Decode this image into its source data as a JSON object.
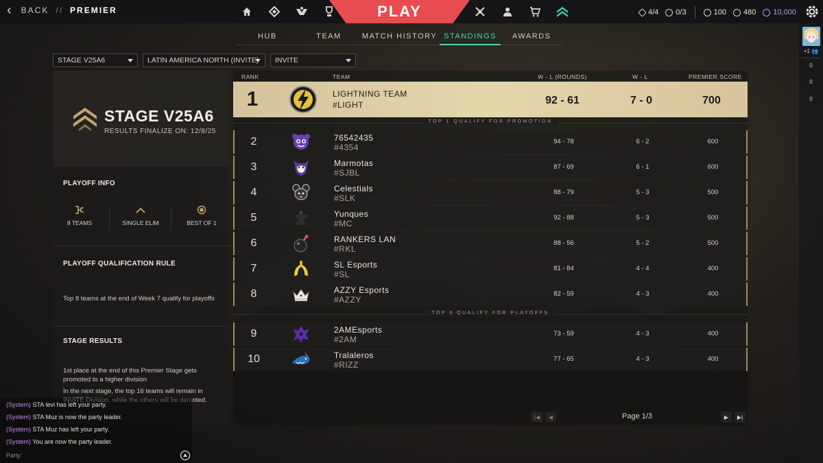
{
  "topbar": {
    "back_label": "BACK",
    "separator": "//",
    "current": "PREMIER",
    "play_label": "PLAY",
    "nav_left_icons": [
      "home-icon",
      "collection-icon",
      "agents-icon",
      "career-icon"
    ],
    "nav_right_icons": [
      "battlepass-icon",
      "career-agent-icon",
      "store-icon",
      "premier-icon"
    ],
    "currencies": {
      "agent_count": "4/4",
      "item_count": "0/3",
      "valorant_points": "100",
      "radianite_points": "480",
      "kingdom_credits": "10,000"
    }
  },
  "tabs": [
    {
      "label": "HUB",
      "active": false
    },
    {
      "label": "TEAM",
      "active": false
    },
    {
      "label": "MATCH HISTORY",
      "active": false
    },
    {
      "label": "STANDINGS",
      "active": true
    },
    {
      "label": "AWARDS",
      "active": false
    }
  ],
  "filters": {
    "stage": "STAGE V25A6",
    "region": "LATIN AMERICA NORTH (INVITE)",
    "division": "INVITE"
  },
  "stage_card": {
    "title": "STAGE V25A6",
    "subtitle": "RESULTS FINALIZE ON: 12/8/25"
  },
  "playoff": {
    "title": "PLAYOFF INFO",
    "teams": "8 TEAMS",
    "format": "SINGLE ELIM",
    "series": "BEST OF 1",
    "qual_title": "PLAYOFF QUALIFICATION RULE",
    "qual_text": "Top 8 teams at the end of Week 7 qualify for playoffs",
    "results_title": "STAGE RESULTS",
    "results_text_1": "1st place at the end of this Premier Stage gets promoted to a higher division",
    "results_text_2": "In the next stage, the top 16 teams will remain in INVITE Division, while the others will be demoted."
  },
  "table": {
    "headers": {
      "rank": "RANK",
      "team": "TEAM",
      "wl_rounds": "W - L (ROUNDS)",
      "wl": "W - L",
      "score": "PREMIER SCORE"
    },
    "promotion_note": "TOP 1 QUALIFY FOR PROMOTION",
    "playoff_note": "TOP 8 QUALIFY FOR PLAYOFFS",
    "rows": [
      {
        "rank": "1",
        "name": "LIGHTNING TEAM",
        "tag": "#LIGHT",
        "wl_rounds": "92 - 61",
        "wl": "7 - 0",
        "score": "700",
        "logo": "lightning-logo-icon"
      },
      {
        "rank": "2",
        "name": "76542435",
        "tag": "#4354",
        "wl_rounds": "94 - 78",
        "wl": "6 - 2",
        "score": "600",
        "logo": "purple-creature-logo-icon"
      },
      {
        "rank": "3",
        "name": "Marmotas",
        "tag": "#SJBL",
        "wl_rounds": "87 - 69",
        "wl": "6 - 1",
        "score": "600",
        "logo": "marmot-logo-icon"
      },
      {
        "rank": "4",
        "name": "Celestials",
        "tag": "#SLK",
        "wl_rounds": "88 - 79",
        "wl": "5 - 3",
        "score": "500",
        "logo": "mouse-logo-icon"
      },
      {
        "rank": "5",
        "name": "Yunques",
        "tag": "#MC",
        "wl_rounds": "92 - 88",
        "wl": "5 - 3",
        "score": "500",
        "logo": "anvil-logo-icon"
      },
      {
        "rank": "6",
        "name": "RANKERS LAN",
        "tag": "#RKL",
        "wl_rounds": "88 - 56",
        "wl": "5 - 2",
        "score": "500",
        "logo": "bomb-logo-icon"
      },
      {
        "rank": "7",
        "name": "SL Esports",
        "tag": "#SL",
        "wl_rounds": "81 - 84",
        "wl": "4 - 4",
        "score": "400",
        "logo": "banana-logo-icon"
      },
      {
        "rank": "8",
        "name": "AZZY Esports",
        "tag": "#AZZY",
        "wl_rounds": "82 - 59",
        "wl": "4 - 3",
        "score": "400",
        "logo": "crown-logo-icon"
      },
      {
        "rank": "9",
        "name": "2AMEsports",
        "tag": "#2AM",
        "wl_rounds": "73 - 59",
        "wl": "4 - 3",
        "score": "400",
        "logo": "phoenix-logo-icon"
      },
      {
        "rank": "10",
        "name": "Tralaleros",
        "tag": "#RIZZ",
        "wl_rounds": "77 - 65",
        "wl": "4 - 3",
        "score": "400",
        "logo": "shark-logo-icon"
      }
    ]
  },
  "pager": {
    "label": "Page 1/3"
  },
  "chat": {
    "lines": [
      {
        "prefix": "(System)",
        "text": "STA levi has left your party."
      },
      {
        "prefix": "(System)",
        "text": "STA Muz is now the party leader."
      },
      {
        "prefix": "(System)",
        "text": "STA Muz has left your party."
      },
      {
        "prefix": "(System)",
        "text": "You are now the party leader."
      }
    ],
    "input_label": "Party:"
  },
  "rail": {
    "party_count": "+1",
    "counts": [
      "0",
      "0",
      "0"
    ]
  },
  "colors": {
    "accent": "#4fd3b4",
    "play": "#e84c50",
    "gold": "#d8c59d",
    "system_text": "#c98bf5"
  }
}
